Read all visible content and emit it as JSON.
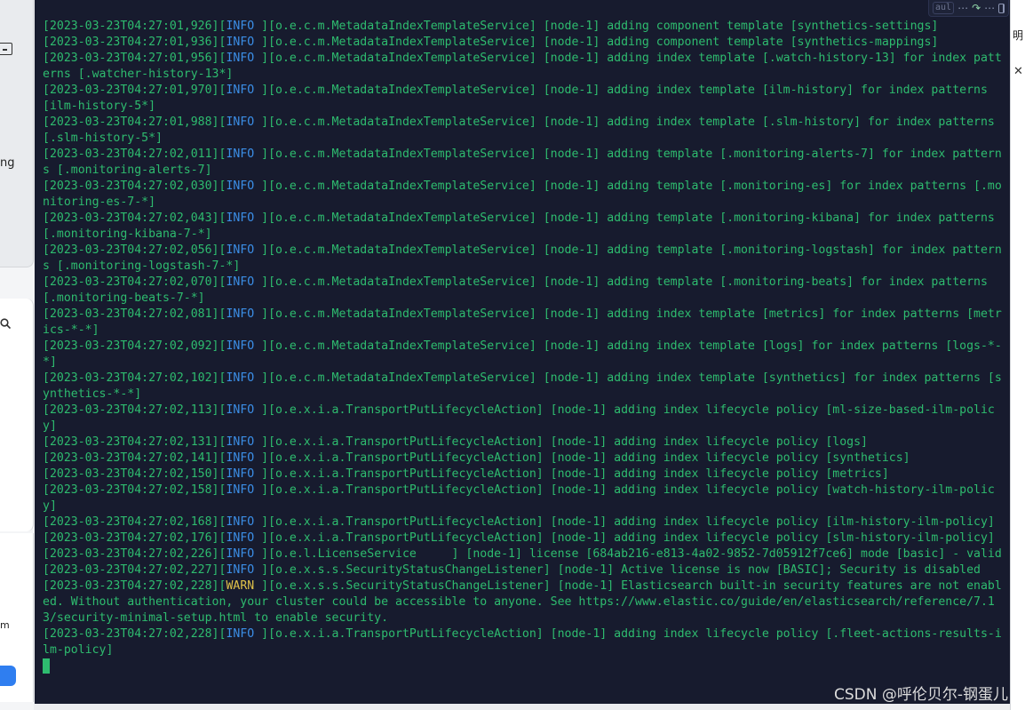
{
  "left_panel": {
    "fragment_1": "ng",
    "fragment_2": "m"
  },
  "right_panel": {
    "fragment": "明",
    "close_glyph": "✕"
  },
  "toolbar": {
    "label": "aul",
    "menu_glyph": "⋯",
    "share_glyph": "↷",
    "more_glyph": "⋯"
  },
  "terminal": {
    "lines": [
      {
        "ts": "[2023-03-23T04:27:01,926]",
        "level": "INFO ",
        "level_type": "info",
        "msg": "][o.e.c.m.MetadataIndexTemplateService] [node-1] adding component template [synthetics-settings]"
      },
      {
        "ts": "[2023-03-23T04:27:01,936]",
        "level": "INFO ",
        "level_type": "info",
        "msg": "][o.e.c.m.MetadataIndexTemplateService] [node-1] adding component template [synthetics-mappings]"
      },
      {
        "ts": "[2023-03-23T04:27:01,956]",
        "level": "INFO ",
        "level_type": "info",
        "msg": "][o.e.c.m.MetadataIndexTemplateService] [node-1] adding index template [.watch-history-13] for index patterns [.watcher-history-13*]"
      },
      {
        "ts": "[2023-03-23T04:27:01,970]",
        "level": "INFO ",
        "level_type": "info",
        "msg": "][o.e.c.m.MetadataIndexTemplateService] [node-1] adding index template [ilm-history] for index patterns [ilm-history-5*]"
      },
      {
        "ts": "[2023-03-23T04:27:01,988]",
        "level": "INFO ",
        "level_type": "info",
        "msg": "][o.e.c.m.MetadataIndexTemplateService] [node-1] adding index template [.slm-history] for index patterns [.slm-history-5*]"
      },
      {
        "ts": "[2023-03-23T04:27:02,011]",
        "level": "INFO ",
        "level_type": "info",
        "msg": "][o.e.c.m.MetadataIndexTemplateService] [node-1] adding template [.monitoring-alerts-7] for index patterns [.monitoring-alerts-7]"
      },
      {
        "ts": "[2023-03-23T04:27:02,030]",
        "level": "INFO ",
        "level_type": "info",
        "msg": "][o.e.c.m.MetadataIndexTemplateService] [node-1] adding template [.monitoring-es] for index patterns [.monitoring-es-7-*]"
      },
      {
        "ts": "[2023-03-23T04:27:02,043]",
        "level": "INFO ",
        "level_type": "info",
        "msg": "][o.e.c.m.MetadataIndexTemplateService] [node-1] adding template [.monitoring-kibana] for index patterns [.monitoring-kibana-7-*]"
      },
      {
        "ts": "[2023-03-23T04:27:02,056]",
        "level": "INFO ",
        "level_type": "info",
        "msg": "][o.e.c.m.MetadataIndexTemplateService] [node-1] adding template [.monitoring-logstash] for index patterns [.monitoring-logstash-7-*]"
      },
      {
        "ts": "[2023-03-23T04:27:02,070]",
        "level": "INFO ",
        "level_type": "info",
        "msg": "][o.e.c.m.MetadataIndexTemplateService] [node-1] adding template [.monitoring-beats] for index patterns [.monitoring-beats-7-*]"
      },
      {
        "ts": "[2023-03-23T04:27:02,081]",
        "level": "INFO ",
        "level_type": "info",
        "msg": "][o.e.c.m.MetadataIndexTemplateService] [node-1] adding index template [metrics] for index patterns [metrics-*-*]"
      },
      {
        "ts": "[2023-03-23T04:27:02,092]",
        "level": "INFO ",
        "level_type": "info",
        "msg": "][o.e.c.m.MetadataIndexTemplateService] [node-1] adding index template [logs] for index patterns [logs-*-*]"
      },
      {
        "ts": "[2023-03-23T04:27:02,102]",
        "level": "INFO ",
        "level_type": "info",
        "msg": "][o.e.c.m.MetadataIndexTemplateService] [node-1] adding index template [synthetics] for index patterns [synthetics-*-*]"
      },
      {
        "ts": "[2023-03-23T04:27:02,113]",
        "level": "INFO ",
        "level_type": "info",
        "msg": "][o.e.x.i.a.TransportPutLifecycleAction] [node-1] adding index lifecycle policy [ml-size-based-ilm-policy]"
      },
      {
        "ts": "[2023-03-23T04:27:02,131]",
        "level": "INFO ",
        "level_type": "info",
        "msg": "][o.e.x.i.a.TransportPutLifecycleAction] [node-1] adding index lifecycle policy [logs]"
      },
      {
        "ts": "[2023-03-23T04:27:02,141]",
        "level": "INFO ",
        "level_type": "info",
        "msg": "][o.e.x.i.a.TransportPutLifecycleAction] [node-1] adding index lifecycle policy [synthetics]"
      },
      {
        "ts": "[2023-03-23T04:27:02,150]",
        "level": "INFO ",
        "level_type": "info",
        "msg": "][o.e.x.i.a.TransportPutLifecycleAction] [node-1] adding index lifecycle policy [metrics]"
      },
      {
        "ts": "[2023-03-23T04:27:02,158]",
        "level": "INFO ",
        "level_type": "info",
        "msg": "][o.e.x.i.a.TransportPutLifecycleAction] [node-1] adding index lifecycle policy [watch-history-ilm-policy]"
      },
      {
        "ts": "[2023-03-23T04:27:02,168]",
        "level": "INFO ",
        "level_type": "info",
        "msg": "][o.e.x.i.a.TransportPutLifecycleAction] [node-1] adding index lifecycle policy [ilm-history-ilm-policy]"
      },
      {
        "ts": "[2023-03-23T04:27:02,176]",
        "level": "INFO ",
        "level_type": "info",
        "msg": "][o.e.x.i.a.TransportPutLifecycleAction] [node-1] adding index lifecycle policy [slm-history-ilm-policy]"
      },
      {
        "ts": "[2023-03-23T04:27:02,226]",
        "level": "INFO ",
        "level_type": "info",
        "msg": "][o.e.l.LicenseService     ] [node-1] license [684ab216-e813-4a02-9852-7d05912f7ce6] mode [basic] - valid"
      },
      {
        "ts": "[2023-03-23T04:27:02,227]",
        "level": "INFO ",
        "level_type": "info",
        "msg": "][o.e.x.s.s.SecurityStatusChangeListener] [node-1] Active license is now [BASIC]; Security is disabled"
      },
      {
        "ts": "[2023-03-23T04:27:02,228]",
        "level": "WARN ",
        "level_type": "warn",
        "msg": "][o.e.x.s.s.SecurityStatusChangeListener] [node-1] Elasticsearch built-in security features are not enabled. Without authentication, your cluster could be accessible to anyone. See https://www.elastic.co/guide/en/elasticsearch/reference/7.13/security-minimal-setup.html to enable security."
      },
      {
        "ts": "[2023-03-23T04:27:02,228]",
        "level": "INFO ",
        "level_type": "info",
        "msg": "][o.e.x.i.a.TransportPutLifecycleAction] [node-1] adding index lifecycle policy [.fleet-actions-results-ilm-policy]"
      }
    ]
  },
  "watermark": "CSDN @呼伦贝尔-钢蛋儿",
  "colors": {
    "terminal_bg": "#171b2e",
    "log_text": "#2ebc6f",
    "info_level": "#3b8ee6",
    "warn_level": "#e0c24a"
  }
}
